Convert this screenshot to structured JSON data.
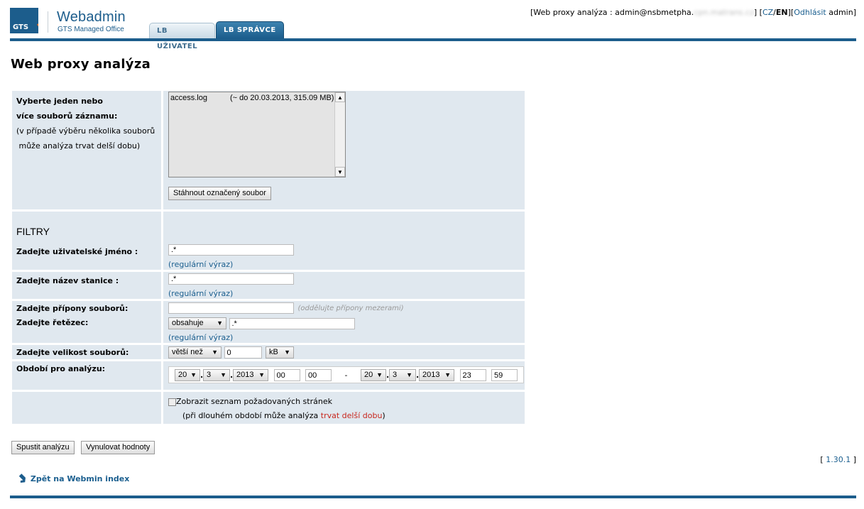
{
  "header": {
    "logo_text": "Webadmin",
    "logo_sub": "GTS Managed Office",
    "logo_badge": "GTS",
    "tabs": [
      {
        "label": "LB UŽIVATEL",
        "active": false
      },
      {
        "label": "LB SPRÁVCE",
        "active": true
      }
    ],
    "userinfo": {
      "prefix": "[Web proxy analýza : admin@nsbmetpha.",
      "hidden": "cpn.matrans.cz",
      "suffix": "] [",
      "lang_cz": "CZ",
      "lang_sep": "/",
      "lang_en": "EN",
      "sep2": "][",
      "logout": "Odhlásit",
      "user": " admin]"
    }
  },
  "page_title": "Web proxy analýza",
  "form": {
    "logs_label_line1": "Vyberte jeden nebo",
    "logs_label_line2": "více souborů záznamu:",
    "logs_note_line1": "(v případě výběru několika souborů",
    "logs_note_line2": " může analýza trvat delší dobu)",
    "log_option_name": "access.log",
    "log_option_info": "(~ do 20.03.2013,  315.09 MB)",
    "download_button": "Stáhnout označený soubor",
    "filters_heading": "FILTRY",
    "username_label": "Zadejte uživatelské jméno :",
    "username_value": ".*",
    "regex_note": "(regulární výraz)",
    "station_label": "Zadejte název stanice :",
    "station_value": ".*",
    "ext_label": "Zadejte přípony souborů:",
    "ext_value": "",
    "ext_hint": "(oddělujte přípony mezerami)",
    "string_label": "Zadejte řetězec:",
    "string_mode": "obsahuje",
    "string_value": ".*",
    "size_label": "Zadejte velikost souborů:",
    "size_mode": "větší než",
    "size_value": "0",
    "size_unit": "kB",
    "period_label": "Období pro analýzu:",
    "from": {
      "day": "20",
      "month": "3",
      "year": "2013",
      "hour": "00",
      "minute": "00"
    },
    "dash": "-",
    "to": {
      "day": "20",
      "month": "3",
      "year": "2013",
      "hour": "23",
      "minute": "59"
    },
    "show_pages_label": "Zobrazit seznam požadovaných stránek",
    "show_pages_note_a": "(při dlouhém období může analýza ",
    "show_pages_note_red": "trvat delší dobu",
    "show_pages_note_b": ")"
  },
  "buttons": {
    "run": "Spustit analýzu",
    "reset": "Vynulovat hodnoty"
  },
  "footer": {
    "version_open": "[ ",
    "version": "1.30.1",
    "version_close": " ]",
    "back_link": "Zpět na Webmin index"
  }
}
